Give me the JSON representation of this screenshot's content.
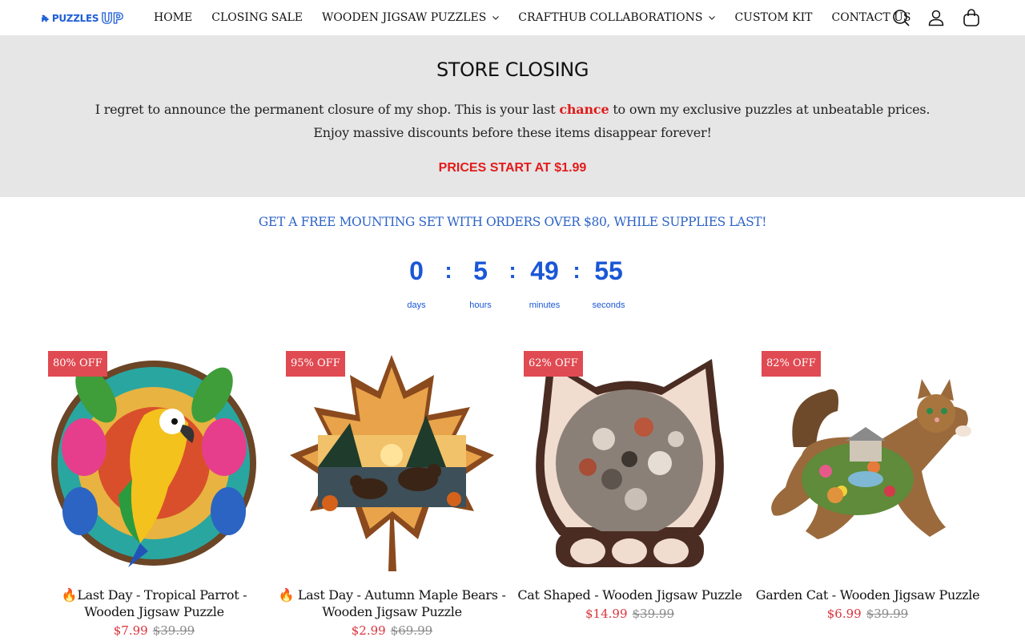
{
  "header": {
    "logo_text": "PUZZLES",
    "logo_up": "UP",
    "nav": [
      {
        "label": "HOME",
        "dropdown": false
      },
      {
        "label": "CLOSING SALE",
        "dropdown": false
      },
      {
        "label": "WOODEN JIGSAW PUZZLES",
        "dropdown": true
      },
      {
        "label": "CRAFTHUB COLLABORATIONS",
        "dropdown": true
      },
      {
        "label": "CUSTOM KIT",
        "dropdown": false
      },
      {
        "label": "CONTACT US",
        "dropdown": false
      }
    ],
    "icons": [
      "search-icon",
      "account-icon",
      "cart-icon"
    ]
  },
  "banner": {
    "title": "STORE CLOSING",
    "line1_before": "I regret to announce the permanent closure of my shop. This is your last ",
    "line1_highlight": "chance",
    "line1_after": " to own my exclusive puzzles at unbeatable prices.",
    "line2": "Enjoy massive discounts before these items disappear forever!",
    "prices": "PRICES START AT $1.99"
  },
  "promo": "GET A FREE MOUNTING SET WITH ORDERS OVER $80, WHILE SUPPLIES LAST!",
  "countdown": {
    "days": "0",
    "hours": "5",
    "minutes": "49",
    "seconds": "55",
    "sep": ":",
    "labels": {
      "days": "days",
      "hours": "hours",
      "minutes": "minutes",
      "seconds": "seconds"
    }
  },
  "products": [
    {
      "badge": "80% OFF",
      "title_line1": "🔥Last Day - Tropical Parrot -",
      "title_line2": "Wooden Jigsaw Puzzle",
      "price": "$7.99",
      "old_price": "$39.99"
    },
    {
      "badge": "95% OFF",
      "title_line1": "🔥 Last Day - Autumn Maple Bears -",
      "title_line2": "Wooden Jigsaw Puzzle",
      "price": "$2.99",
      "old_price": "$69.99"
    },
    {
      "badge": "62% OFF",
      "title_line1": "Cat Shaped - Wooden Jigsaw Puzzle",
      "title_line2": "",
      "price": "$14.99",
      "old_price": "$39.99"
    },
    {
      "badge": "82% OFF",
      "title_line1": "Garden Cat - Wooden Jigsaw Puzzle",
      "title_line2": "",
      "price": "$6.99",
      "old_price": "$39.99"
    }
  ],
  "colors": {
    "brand_blue": "#1f5fd6",
    "countdown_blue": "#1a57d6",
    "sale_red": "#e31b1b",
    "badge_red": "#e04a52",
    "banner_bg": "#e6e6e6"
  }
}
